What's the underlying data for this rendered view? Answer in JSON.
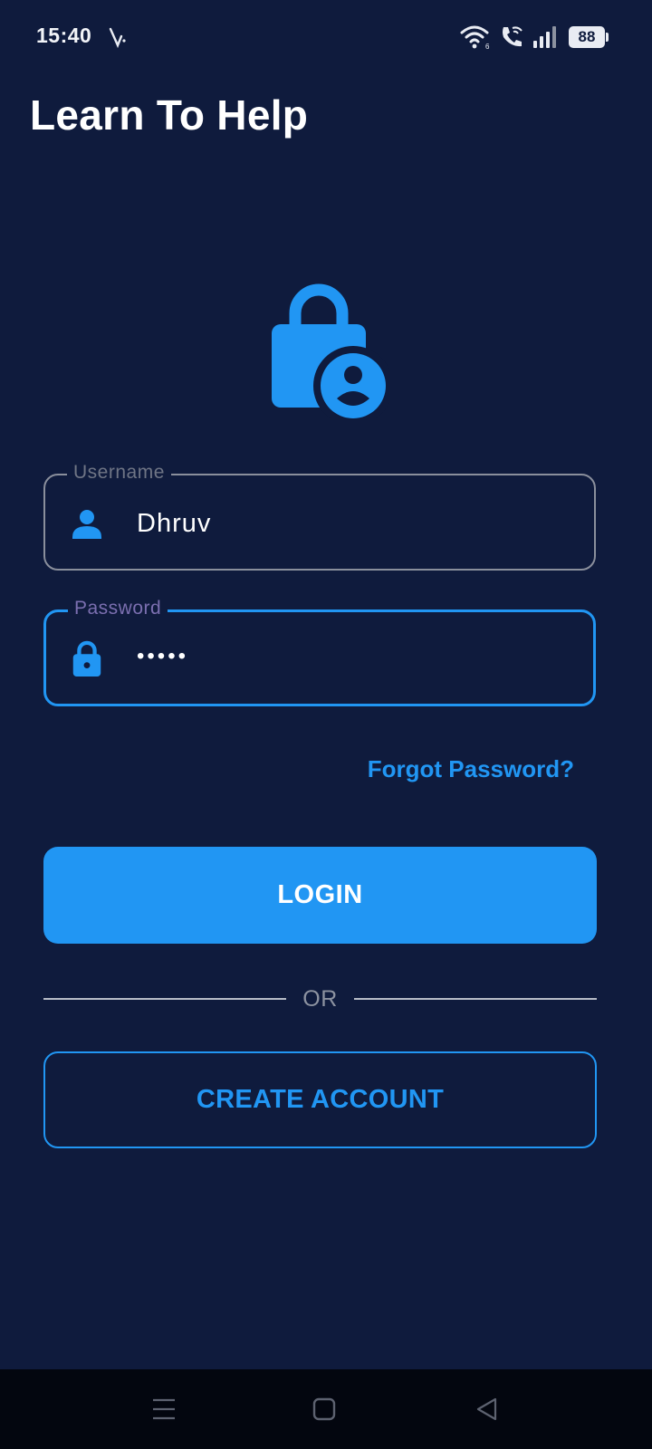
{
  "status_bar": {
    "time": "15:40",
    "battery": "88",
    "icons": [
      "notification-icon",
      "wifi-icon",
      "wifi-call-icon",
      "signal-icon",
      "battery-icon"
    ]
  },
  "app": {
    "title": "Learn To Help"
  },
  "hero": {
    "icon": "lock-person-icon"
  },
  "form": {
    "username": {
      "label": "Username",
      "value": "Dhruv",
      "icon": "person-icon"
    },
    "password": {
      "label": "Password",
      "value": "•••••",
      "icon": "lock-icon",
      "focused": true
    },
    "forgot_label": "Forgot Password?",
    "login_label": "LOGIN",
    "divider_label": "OR",
    "create_label": "CREATE ACCOUNT"
  },
  "nav_bar": {
    "icons": [
      "menu-icon",
      "home-icon",
      "back-icon"
    ]
  },
  "colors": {
    "background": "#0f1b3d",
    "accent": "#2196f3",
    "nav_background": "#03060f"
  }
}
